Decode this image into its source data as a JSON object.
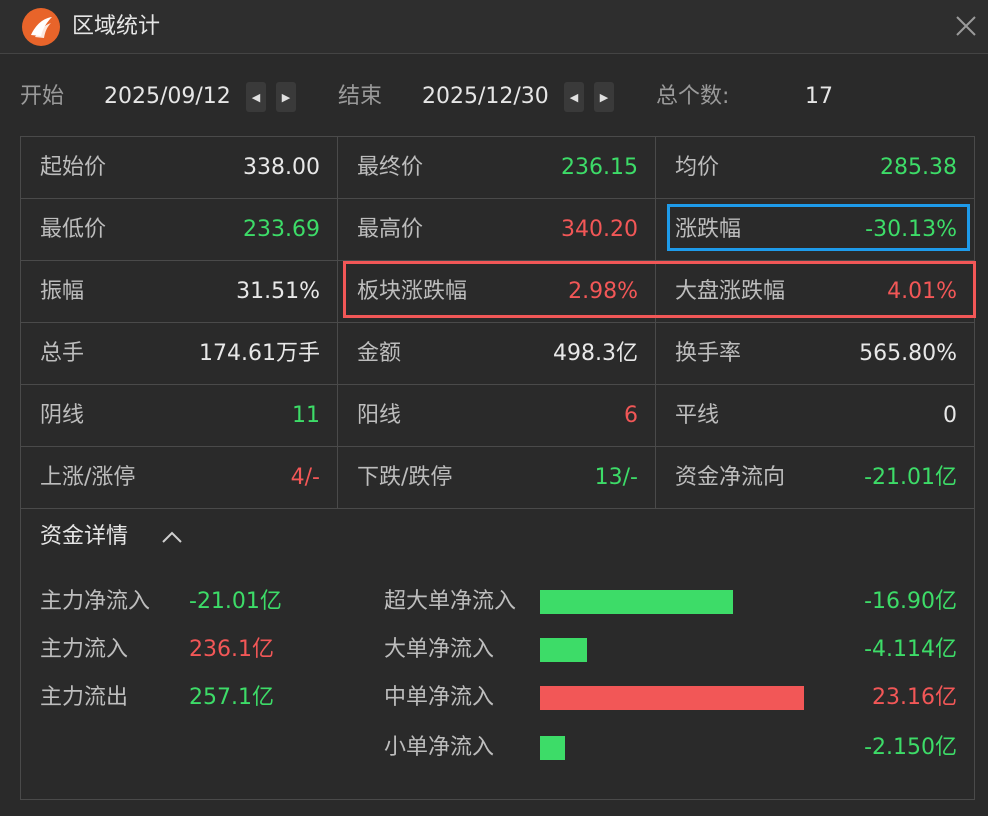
{
  "window": {
    "title": "区域统计"
  },
  "range": {
    "start_label": "开始",
    "start_value": "2025/09/12",
    "end_label": "结束",
    "end_value": "2025/12/30",
    "count_label": "总个数:",
    "count_value": "17"
  },
  "stats": [
    [
      {
        "k": "起始价",
        "v": "338.00",
        "c": "white"
      },
      {
        "k": "最终价",
        "v": "236.15",
        "c": "green"
      },
      {
        "k": "均价",
        "v": "285.38",
        "c": "green"
      }
    ],
    [
      {
        "k": "最低价",
        "v": "233.69",
        "c": "green"
      },
      {
        "k": "最高价",
        "v": "340.20",
        "c": "red"
      },
      {
        "k": "涨跌幅",
        "v": "-30.13%",
        "c": "green"
      }
    ],
    [
      {
        "k": "振幅",
        "v": "31.51%",
        "c": "white"
      },
      {
        "k": "板块涨跌幅",
        "v": "2.98%",
        "c": "red"
      },
      {
        "k": "大盘涨跌幅",
        "v": "4.01%",
        "c": "red"
      }
    ],
    [
      {
        "k": "总手",
        "v": "174.61万手",
        "c": "white"
      },
      {
        "k": "金额",
        "v": "498.3亿",
        "c": "white"
      },
      {
        "k": "换手率",
        "v": "565.80%",
        "c": "white"
      }
    ],
    [
      {
        "k": "阴线",
        "v": "11",
        "c": "green"
      },
      {
        "k": "阳线",
        "v": "6",
        "c": "red"
      },
      {
        "k": "平线",
        "v": "0",
        "c": "white"
      }
    ],
    [
      {
        "k": "上涨/涨停",
        "v": "4/-",
        "c": "red"
      },
      {
        "k": "下跌/跌停",
        "v": "13/-",
        "c": "green"
      },
      {
        "k": "资金净流向",
        "v": "-21.01亿",
        "c": "green"
      }
    ]
  ],
  "detail": {
    "title": "资金详情",
    "left": [
      {
        "k": "主力净流入",
        "v": "-21.01亿",
        "c": "green"
      },
      {
        "k": "主力流入",
        "v": "236.1亿",
        "c": "red"
      },
      {
        "k": "主力流出",
        "v": "257.1亿",
        "c": "green"
      }
    ],
    "flows": [
      {
        "k": "超大单净流入",
        "v": "-16.90亿",
        "amount": -16.9,
        "c": "green"
      },
      {
        "k": "大单净流入",
        "v": "-4.114亿",
        "amount": -4.114,
        "c": "green"
      },
      {
        "k": "中单净流入",
        "v": "23.16亿",
        "amount": 23.16,
        "c": "red"
      },
      {
        "k": "小单净流入",
        "v": "-2.150亿",
        "amount": -2.15,
        "c": "green"
      }
    ]
  },
  "colors": {
    "green": "#3ddc68",
    "red": "#f25757",
    "highlight_blue": "#1e9bea",
    "logo": "#e8642a"
  },
  "icons": {
    "logo": "app-logo-icon",
    "close": "close-icon",
    "collapse": "chevron-up-icon",
    "prev": "arrow-left-icon",
    "next": "arrow-right-icon"
  }
}
